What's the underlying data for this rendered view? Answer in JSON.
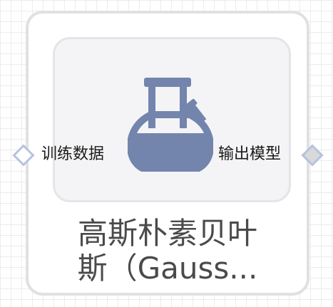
{
  "node": {
    "title_line1": "高斯朴素贝叶",
    "title_line2": "斯（Gauss...",
    "input_port_label": "训练数据",
    "output_port_label": "输出模型",
    "icon": "flask-icon"
  },
  "colors": {
    "icon_fill": "#7385ad",
    "port_border": "#b6c2e2",
    "title_text": "#4a4a4a"
  }
}
